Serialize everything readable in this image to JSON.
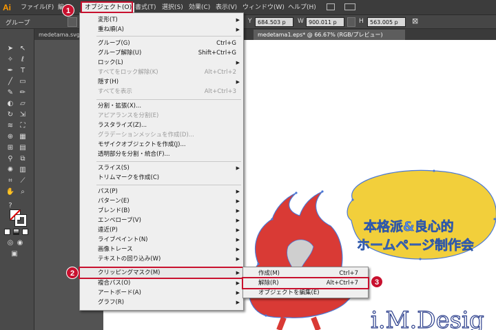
{
  "app": {
    "logo": "Ai"
  },
  "menubar": {
    "items": [
      "ファイル(F)",
      "編",
      "オブジェクト(O)",
      "書式(T)",
      "選択(S)",
      "効果(C)",
      "表示(V)",
      "ウィンドウ(W)",
      "ヘルプ(H)"
    ]
  },
  "controlbar": {
    "label": "グループ",
    "y_label": "Y",
    "y_value": "684.503 p",
    "w_label": "W",
    "w_value": "900.011 p",
    "h_label": "H",
    "h_value": "563.005 p"
  },
  "tabs": [
    {
      "label": "medetama.svg* @ 66.67% ..."
    },
    {
      "label": "medetama1.eps* @ 66.67% (RGB/プレビュー)"
    }
  ],
  "object_menu": {
    "items": [
      {
        "label": "変形(T)",
        "shortcut": "",
        "submenu": true,
        "disabled": false
      },
      {
        "label": "重ね順(A)",
        "shortcut": "",
        "submenu": true,
        "disabled": false
      },
      {
        "label": "グループ(G)",
        "shortcut": "Ctrl+G",
        "submenu": false,
        "disabled": false
      },
      {
        "label": "グループ解除(U)",
        "shortcut": "Shift+Ctrl+G",
        "submenu": false,
        "disabled": false
      },
      {
        "label": "ロック(L)",
        "shortcut": "",
        "submenu": true,
        "disabled": false
      },
      {
        "label": "すべてをロック解除(K)",
        "shortcut": "Alt+Ctrl+2",
        "submenu": false,
        "disabled": true
      },
      {
        "label": "隠す(H)",
        "shortcut": "",
        "submenu": true,
        "disabled": false
      },
      {
        "label": "すべてを表示",
        "shortcut": "Alt+Ctrl+3",
        "submenu": false,
        "disabled": true
      },
      {
        "label": "分割・拡張(X)...",
        "shortcut": "",
        "submenu": false,
        "disabled": false
      },
      {
        "label": "アピアランスを分割(E)",
        "shortcut": "",
        "submenu": false,
        "disabled": true
      },
      {
        "label": "ラスタライズ(Z)...",
        "shortcut": "",
        "submenu": false,
        "disabled": false
      },
      {
        "label": "グラデーションメッシュを作成(D)...",
        "shortcut": "",
        "submenu": false,
        "disabled": true
      },
      {
        "label": "モザイクオブジェクトを作成(J)...",
        "shortcut": "",
        "submenu": false,
        "disabled": false
      },
      {
        "label": "透明部分を分割・統合(F)...",
        "shortcut": "",
        "submenu": false,
        "disabled": false
      },
      {
        "label": "スライス(S)",
        "shortcut": "",
        "submenu": true,
        "disabled": false
      },
      {
        "label": "トリムマークを作成(C)",
        "shortcut": "",
        "submenu": false,
        "disabled": false
      },
      {
        "label": "パス(P)",
        "shortcut": "",
        "submenu": true,
        "disabled": false
      },
      {
        "label": "パターン(E)",
        "shortcut": "",
        "submenu": true,
        "disabled": false
      },
      {
        "label": "ブレンド(B)",
        "shortcut": "",
        "submenu": true,
        "disabled": false
      },
      {
        "label": "エンベロープ(V)",
        "shortcut": "",
        "submenu": true,
        "disabled": false
      },
      {
        "label": "遠近(P)",
        "shortcut": "",
        "submenu": true,
        "disabled": false
      },
      {
        "label": "ライブペイント(N)",
        "shortcut": "",
        "submenu": true,
        "disabled": false
      },
      {
        "label": "画像トレース",
        "shortcut": "",
        "submenu": true,
        "disabled": false
      },
      {
        "label": "テキストの回り込み(W)",
        "shortcut": "",
        "submenu": true,
        "disabled": false
      },
      {
        "label": "クリッピングマスク(M)",
        "shortcut": "",
        "submenu": true,
        "disabled": false
      },
      {
        "label": "複合パス(O)",
        "shortcut": "",
        "submenu": true,
        "disabled": false
      },
      {
        "label": "アートボード(A)",
        "shortcut": "",
        "submenu": true,
        "disabled": false
      },
      {
        "label": "グラフ(R)",
        "shortcut": "",
        "submenu": true,
        "disabled": false
      }
    ]
  },
  "clipping_submenu": {
    "items": [
      {
        "label": "作成(M)",
        "shortcut": "Ctrl+7"
      },
      {
        "label": "解除(R)",
        "shortcut": "Alt+Ctrl+7"
      },
      {
        "label": "オブジェクトを編集(E)",
        "shortcut": ""
      }
    ]
  },
  "steps": [
    "1",
    "2",
    "3"
  ],
  "artwork": {
    "bubble_line1": "本格派&良心的",
    "bubble_line2": "ホームページ制作会",
    "logo_text": "i.M.Desig"
  },
  "colors": {
    "accent": "#c8102e",
    "flame": "#d93a35",
    "bubble": "#f2cf3b",
    "selection": "#4a78d6"
  }
}
